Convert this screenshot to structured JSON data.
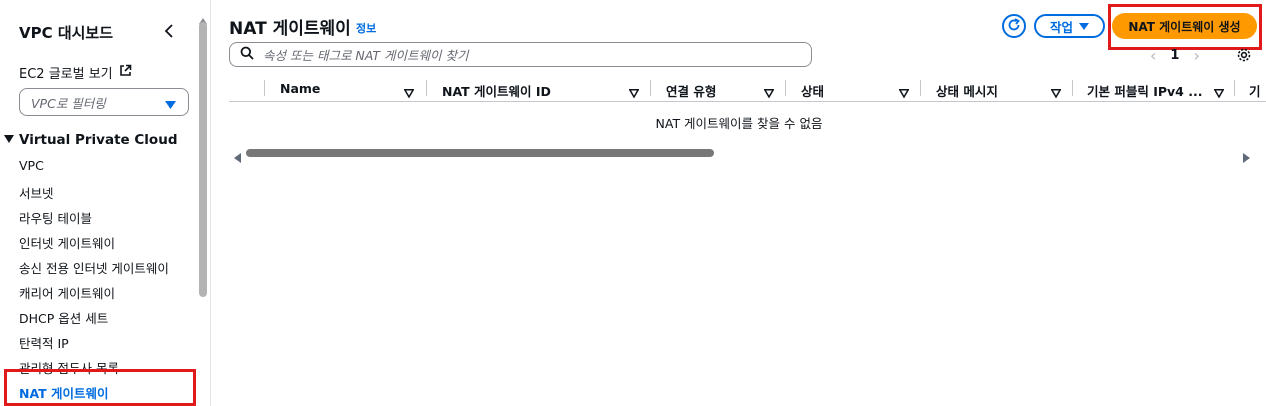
{
  "sidebar": {
    "title": "VPC 대시보드",
    "ec2_link": "EC2 글로벌 보기",
    "filter_placeholder": "VPC로 필터링",
    "section": "Virtual Private Cloud",
    "items": [
      {
        "label": "VPC"
      },
      {
        "label": "서브넷"
      },
      {
        "label": "라우팅 테이블"
      },
      {
        "label": "인터넷 게이트웨이"
      },
      {
        "label": "송신 전용 인터넷 게이트웨이"
      },
      {
        "label": "캐리어 게이트웨이"
      },
      {
        "label": "DHCP 옵션 세트"
      },
      {
        "label": "탄력적 IP"
      },
      {
        "label": "관리형 접두사 목록"
      },
      {
        "label": "NAT 게이트웨이",
        "active": true
      }
    ]
  },
  "header": {
    "title": "NAT 게이트웨이",
    "info": "정보",
    "action_label": "작업",
    "create_label": "NAT 게이트웨이 생성"
  },
  "search": {
    "placeholder": "속성 또는 태그로 NAT 게이트웨이 찾기"
  },
  "pagination": {
    "current_page": "1"
  },
  "table": {
    "columns": [
      "Name",
      "NAT 게이트웨이 ID",
      "연결 유형",
      "상태",
      "상태 메시지",
      "기본 퍼블릭 IPv4 ...",
      "기"
    ],
    "empty_message": "NAT 게이트웨이를 찾을 수 없음"
  },
  "colors": {
    "accent": "#006ce0",
    "primary_button": "#ff9900",
    "highlight_box": "#e01a1a"
  },
  "icons": [
    "chevron-left-icon",
    "external-link-icon",
    "caret-down-icon",
    "triangle-down-icon",
    "refresh-icon",
    "search-icon",
    "settings-icon",
    "sort-icon"
  ]
}
